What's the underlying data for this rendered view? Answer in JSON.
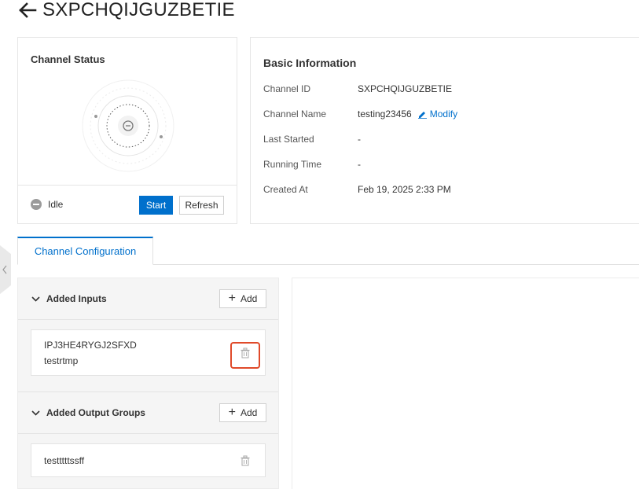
{
  "header": {
    "title": "SXPCHQIJGUZBETIE",
    "back_icon": "arrow-left-icon"
  },
  "status_card": {
    "title": "Channel Status",
    "state": "Idle",
    "start_label": "Start",
    "refresh_label": "Refresh"
  },
  "basic_info": {
    "title": "Basic Information",
    "rows": [
      {
        "label": "Channel ID",
        "value": "SXPCHQIJGUZBETIE"
      },
      {
        "label": "Channel Name",
        "value": "testing23456"
      },
      {
        "label": "Last Started",
        "value": "-"
      },
      {
        "label": "Running Time",
        "value": "-"
      },
      {
        "label": "Created At",
        "value": "Feb 19, 2025 2:33 PM"
      }
    ],
    "modify_label": "Modify"
  },
  "tabs": [
    {
      "label": "Channel Configuration",
      "active": true
    }
  ],
  "inputs_section": {
    "title": "Added Inputs",
    "add_label": "Add",
    "items": [
      {
        "id": "IPJ3HE4RYGJ2SFXD",
        "name": "testrtmp"
      }
    ]
  },
  "outputs_section": {
    "title": "Added Output Groups",
    "add_label": "Add",
    "items": [
      {
        "name": "testttttssff"
      }
    ]
  },
  "colors": {
    "accent": "#0070cc",
    "highlight": "#e04a2a",
    "idle": "#9b9b9b"
  }
}
